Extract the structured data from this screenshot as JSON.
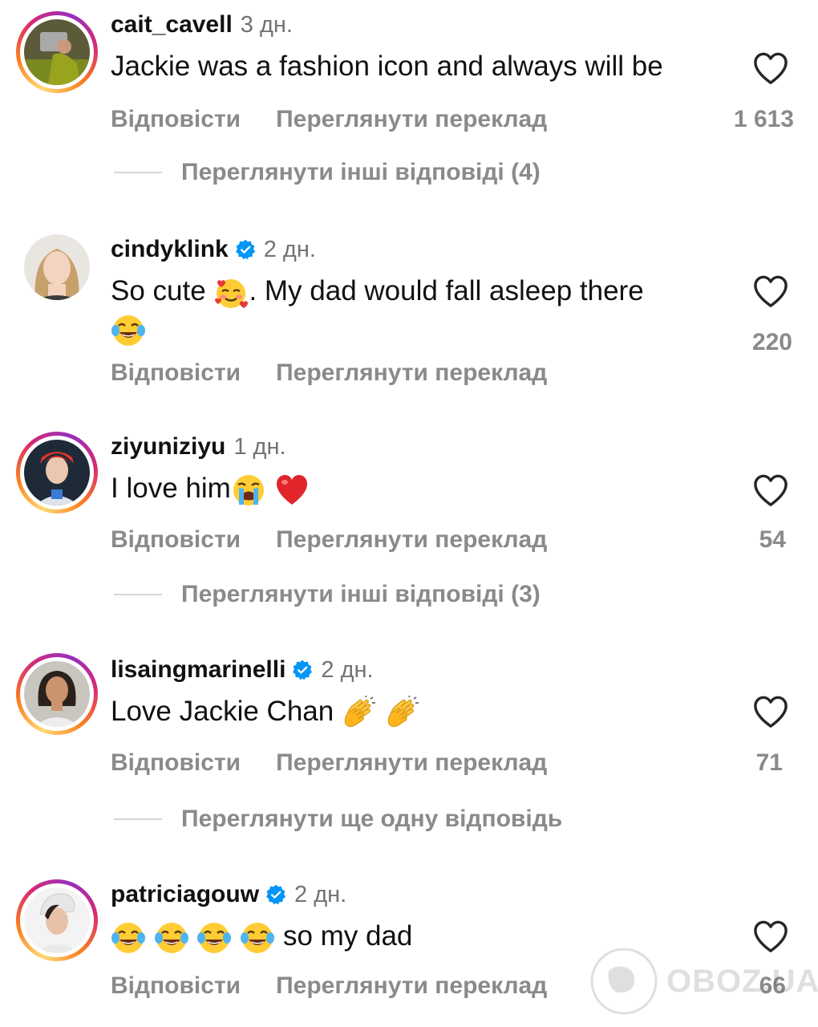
{
  "comments": [
    {
      "username": "cait_cavell",
      "verified": false,
      "time": "3 дн.",
      "text": "Jackie was a fashion icon and always will be",
      "reply_label": "Відповісти",
      "translate_label": "Переглянути переклад",
      "likes": "1 613",
      "more_replies": "Переглянути інші відповіді (4)"
    },
    {
      "username": "cindyklink",
      "verified": true,
      "time": "2 дн.",
      "text_before": "So cute",
      "text_after": ". My dad would fall asleep there",
      "emojis": [
        "smiling-face-with-hearts",
        "face-with-tears-of-joy"
      ],
      "reply_label": "Відповісти",
      "translate_label": "Переглянути переклад",
      "likes": "220"
    },
    {
      "username": "ziyuniziyu",
      "verified": false,
      "time": "1 дн.",
      "text": "I love him",
      "emojis": [
        "loudly-crying-face",
        "red-heart"
      ],
      "reply_label": "Відповісти",
      "translate_label": "Переглянути переклад",
      "likes": "54",
      "more_replies": "Переглянути інші відповіді (3)"
    },
    {
      "username": "lisaingmarinelli",
      "verified": true,
      "time": "2 дн.",
      "text": "Love Jackie Chan",
      "emojis": [
        "clapping-hands",
        "clapping-hands"
      ],
      "reply_label": "Відповісти",
      "translate_label": "Переглянути переклад",
      "likes": "71",
      "more_replies": "Переглянути ще одну відповідь"
    },
    {
      "username": "patriciagouw",
      "verified": true,
      "time": "2 дн.",
      "text": "so my dad",
      "emojis": [
        "face-with-tears-of-joy",
        "face-with-tears-of-joy",
        "face-with-tears-of-joy",
        "face-with-tears-of-joy"
      ],
      "reply_label": "Відповісти",
      "translate_label": "Переглянути переклад",
      "likes": "66"
    }
  ],
  "watermark": "OBOZ.UA",
  "colors": {
    "text": "#111111",
    "muted": "#8a8a8a",
    "verified": "#0095f6",
    "ring_gradient": [
      "#feda75",
      "#fa7e1e",
      "#d62976",
      "#962fbf"
    ]
  }
}
